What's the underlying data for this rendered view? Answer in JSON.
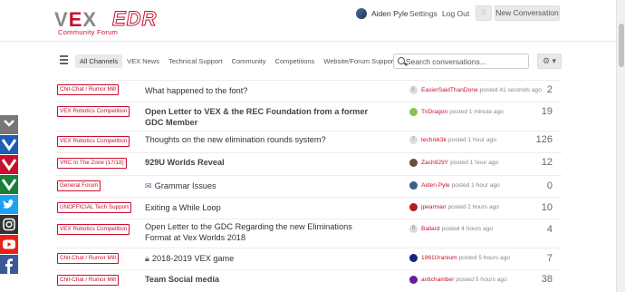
{
  "header": {
    "logo": {
      "vex_text": "VEX",
      "edr_text": "EDR",
      "sub": "Community Forum"
    },
    "user_name": "Aiden Pyle",
    "settings_label": "Settings",
    "logout_label": "Log Out",
    "grid_icon": "grid-icon",
    "new_conversation_label": "New Conversation"
  },
  "nav": {
    "channels": [
      {
        "label": "All Channels",
        "active": true
      },
      {
        "label": "VEX News"
      },
      {
        "label": "Technical Support"
      },
      {
        "label": "Community"
      },
      {
        "label": "Competitions"
      },
      {
        "label": "Website/Forum Support"
      }
    ],
    "search_placeholder": "Search conversations...",
    "settings_icon": "gear-icon"
  },
  "conversations": [
    {
      "tag": "Chit-Chat / Rumor Mill",
      "title": "What happened to the font?",
      "bold": false,
      "user": "EasierSaidThanDone",
      "action": "posted 41 seconds ago",
      "count": "2",
      "avatar": "#ddd",
      "avatar_letter": "E"
    },
    {
      "tag": "VEX Robotics Competition",
      "title": "Open Letter to VEX & the REC Foundation from a former GDC Member",
      "bold": true,
      "user": "TriDragon",
      "action": "posted 1 minute ago",
      "count": "19",
      "avatar": "#8bc34a"
    },
    {
      "tag": "VEX Robotics Competition",
      "title": "Thoughts on the new elimination rounds system?",
      "bold": false,
      "user": "technik3k",
      "action": "posted 1 hour ago",
      "count": "126",
      "avatar": "#ddd",
      "avatar_letter": "T"
    },
    {
      "tag": "VRC In The Zone (17/18)",
      "title": "929U Worlds Reveal",
      "bold": true,
      "user": "Zach929Y",
      "action": "posted 1 hour ago",
      "count": "12",
      "avatar": "#6d4c41"
    },
    {
      "tag": "General Forum",
      "title": "Grammar Issues",
      "bold": false,
      "prefix": "envelope-icon",
      "user": "Aiden Pyle",
      "action": "posted 1 hour ago",
      "count": "0",
      "avatar": "#3f5f8f"
    },
    {
      "tag": "UNOFFICIAL Tech Support",
      "title": "Exiting a While Loop",
      "bold": false,
      "user": "jpearman",
      "action": "posted 2 hours ago",
      "count": "10",
      "avatar": "#b71c1c"
    },
    {
      "tag": "VEX Robotics Competition",
      "title": "Open Letter to the GDC Regarding the new Eliminations Format at Vex Worlds 2018",
      "bold": false,
      "user": "Ballard",
      "action": "posted 4 hours ago",
      "count": "4",
      "avatar": "#ddd",
      "avatar_letter": "B"
    },
    {
      "tag": "Chit-Chat / Rumor Mill",
      "title": "2018-2019 VEX game",
      "bold": false,
      "prefix": "lock-icon",
      "user": "1961Uranium",
      "action": "posted 5 hours ago",
      "count": "7",
      "avatar": "#1a237e"
    },
    {
      "tag": "Chit-Chat / Rumor Mill",
      "title": "Team Social media",
      "bold": true,
      "user": "antichamber",
      "action": "posted 5 hours ago",
      "count": "38",
      "avatar": "#6a1b9a"
    }
  ],
  "share_bar": [
    "collapse-icon",
    "vex-logo-icon",
    "vex-logo-icon",
    "vex-logo-icon",
    "twitter-icon",
    "instagram-icon",
    "youtube-icon",
    "facebook-icon"
  ],
  "colors": {
    "accent": "#c8102e",
    "twitter": "#1da1f2",
    "youtube": "#e62117",
    "facebook": "#3b5998",
    "instagram": "#333"
  }
}
